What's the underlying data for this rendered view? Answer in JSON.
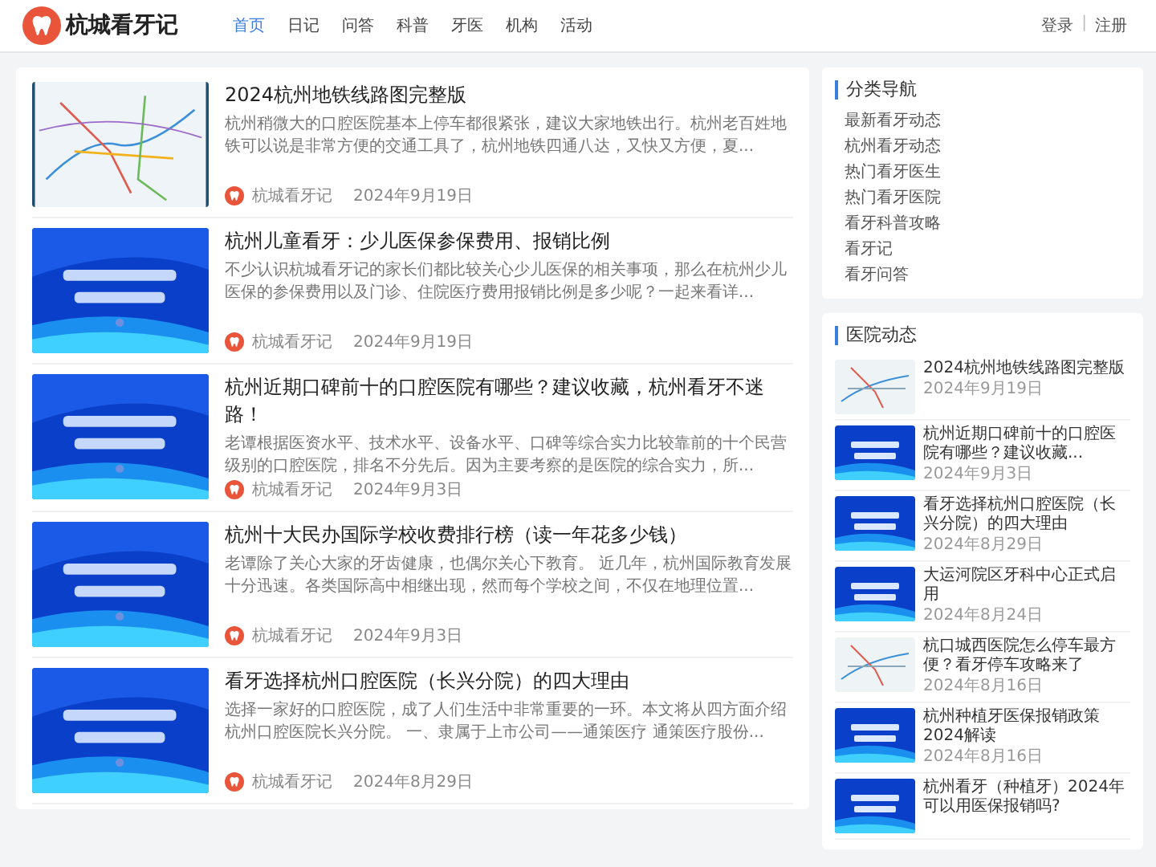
{
  "header": {
    "logo_text": "杭城看牙记",
    "nav": [
      {
        "label": "首页",
        "selected": true
      },
      {
        "label": "日记",
        "selected": false
      },
      {
        "label": "问答",
        "selected": false
      },
      {
        "label": "科普",
        "selected": false
      },
      {
        "label": "牙医",
        "selected": false
      },
      {
        "label": "机构",
        "selected": false
      },
      {
        "label": "活动",
        "selected": false
      }
    ],
    "login": "登录",
    "separator": "|",
    "register": "注册"
  },
  "articles": [
    {
      "title": "2024杭州地铁线路图完整版",
      "excerpt": "杭州稍微大的口腔医院基本上停车都很紧张，建议大家地铁出行。杭州老百姓地铁可以说是非常方便的交通工具了，杭州地铁四通八达，又快又方便，夏...",
      "author": "杭城看牙记",
      "date": "2024年9月19日"
    },
    {
      "title": "杭州儿童看牙：少儿医保参保费用、报销比例",
      "excerpt": "不少认识杭城看牙记的家长们都比较关心少儿医保的相关事项，那么在杭州少儿医保的参保费用以及门诊、住院医疗费用报销比例是多少呢？一起来看详...",
      "author": "杭城看牙记",
      "date": "2024年9月19日"
    },
    {
      "title": "杭州近期口碑前十的口腔医院有哪些？建议收藏，杭州看牙不迷路！",
      "excerpt": "老谭根据医资水平、技术水平、设备水平、口碑等综合实力比较靠前的十个民营级别的口腔医院，排名不分先后。因为主要考察的是医院的综合实力，所...",
      "author": "杭城看牙记",
      "date": "2024年9月3日"
    },
    {
      "title": "杭州十大民办国际学校收费排行榜（读一年花多少钱）",
      "excerpt": "老谭除了关心大家的牙齿健康，也偶尔关心下教育。 近几年，杭州国际教育发展十分迅速。各类国际高中相继出现，然而每个学校之间，不仅在地理位置...",
      "author": "杭城看牙记",
      "date": "2024年9月3日"
    },
    {
      "title": "看牙选择杭州口腔医院（长兴分院）的四大理由",
      "excerpt": "选择一家好的口腔医院，成了人们生活中非常重要的一环。本文将从四方面介绍杭州口腔医院长兴分院。 一、隶属于上市公司——通策医疗 通策医疗股份...",
      "author": "杭城看牙记",
      "date": "2024年8月29日"
    }
  ],
  "sidebar": {
    "categories": {
      "title": "分类导航",
      "items": [
        "最新看牙动态",
        "杭州看牙动态",
        "热门看牙医生",
        "热门看牙医院",
        "看牙科普攻略",
        "看牙记",
        "看牙问答"
      ]
    },
    "news": {
      "title": "医院动态",
      "items": [
        {
          "title": "2024杭州地铁线路图完整版",
          "date": "2024年9月19日"
        },
        {
          "title": "杭州近期口碑前十的口腔医院有哪些？建议收藏...",
          "date": "2024年9月3日"
        },
        {
          "title": "看牙选择杭州口腔医院（长兴分院）的四大理由",
          "date": "2024年8月29日"
        },
        {
          "title": "大运河院区牙科中心正式启用",
          "date": "2024年8月24日"
        },
        {
          "title": "杭口城西医院怎么停车最方便？看牙停车攻略来了",
          "date": "2024年8月16日"
        },
        {
          "title": "杭州种植牙医保报销政策2024解读",
          "date": "2024年8月16日"
        },
        {
          "title": "杭州看牙（种植牙）2024年可以用医保报销吗?"
        }
      ]
    }
  }
}
